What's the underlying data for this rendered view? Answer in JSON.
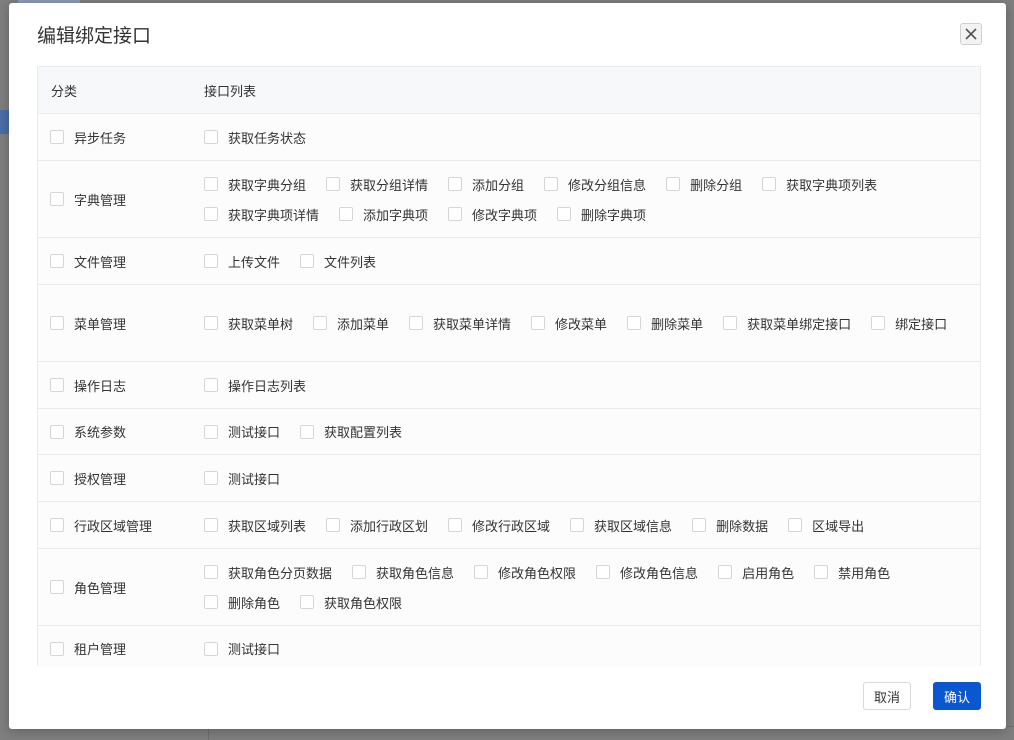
{
  "dialog": {
    "title": "编辑绑定接口",
    "cancel_label": "取消",
    "confirm_label": "确认"
  },
  "table": {
    "header_category": "分类",
    "header_apis": "接口列表",
    "rows": [
      {
        "category": "异步任务",
        "apis": [
          "获取任务状态"
        ]
      },
      {
        "category": "字典管理",
        "apis": [
          "获取字典分组",
          "获取分组详情",
          "添加分组",
          "修改分组信息",
          "删除分组",
          "获取字典项列表",
          "获取字典项详情",
          "添加字典项",
          "修改字典项",
          "删除字典项"
        ]
      },
      {
        "category": "文件管理",
        "apis": [
          "上传文件",
          "文件列表"
        ]
      },
      {
        "category": "菜单管理",
        "apis": [
          "获取菜单树",
          "添加菜单",
          "获取菜单详情",
          "修改菜单",
          "删除菜单",
          "获取菜单绑定接口",
          "绑定接口"
        ]
      },
      {
        "category": "操作日志",
        "apis": [
          "操作日志列表"
        ]
      },
      {
        "category": "系统参数",
        "apis": [
          "测试接口",
          "获取配置列表"
        ]
      },
      {
        "category": "授权管理",
        "apis": [
          "测试接口"
        ]
      },
      {
        "category": "行政区域管理",
        "apis": [
          "获取区域列表",
          "添加行政区划",
          "修改行政区域",
          "获取区域信息",
          "删除数据",
          "区域导出"
        ]
      },
      {
        "category": "角色管理",
        "apis": [
          "获取角色分页数据",
          "获取角色信息",
          "修改角色权限",
          "修改角色信息",
          "启用角色",
          "禁用角色",
          "删除角色",
          "获取角色权限"
        ]
      },
      {
        "category": "租户管理",
        "apis": [
          "测试接口"
        ]
      }
    ]
  }
}
